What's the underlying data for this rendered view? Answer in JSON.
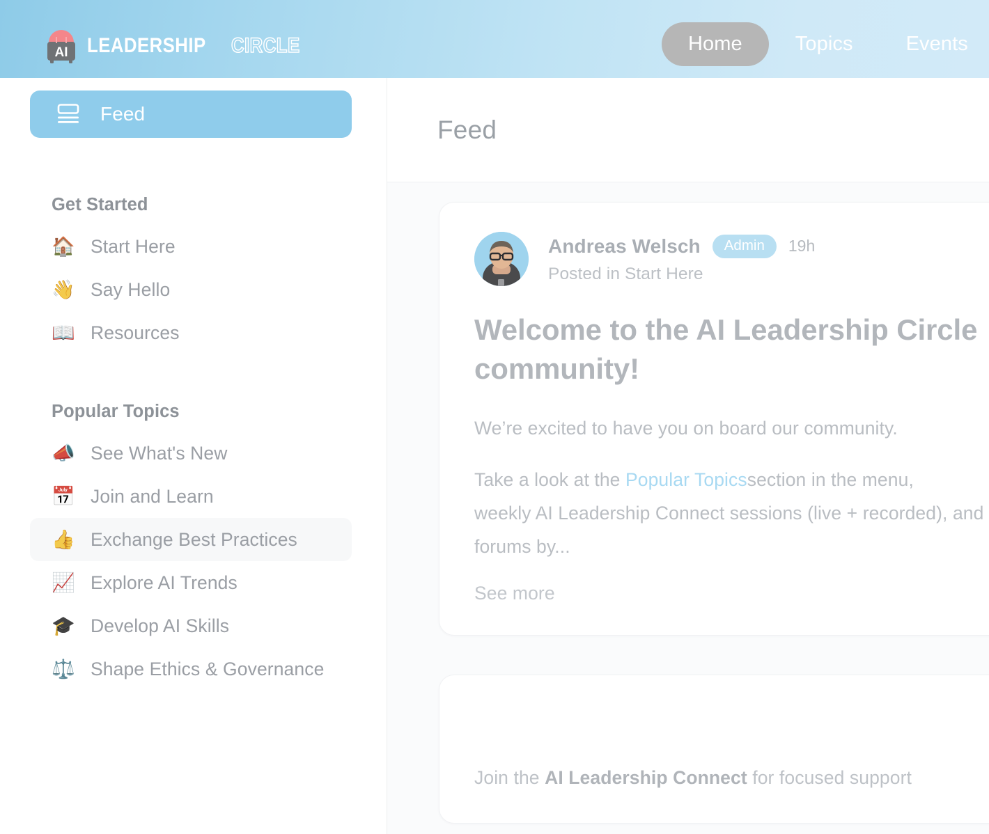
{
  "brand": {
    "logo_icon": "ai-robot-head-icon",
    "word_solid": "LEADERSHIP",
    "word_outline": "CIRCLE",
    "mark_text": "AI",
    "colors": {
      "dome": "#f4868a",
      "body": "#6f7275",
      "header_left": "#8ecbe8",
      "header_right": "#d2eaf8"
    }
  },
  "topnav": {
    "items": [
      {
        "label": "Home",
        "active": true
      },
      {
        "label": "Topics",
        "active": false
      },
      {
        "label": "Events",
        "active": false
      }
    ],
    "active_pill_color": "#b6b6b6"
  },
  "sidebar": {
    "feed": {
      "label": "Feed",
      "icon": "feed-icon",
      "active": true,
      "accent": "#8fcceb"
    },
    "sections": [
      {
        "title": "Get Started",
        "items": [
          {
            "emoji": "🏠",
            "icon_name": "house-emoji",
            "label": "Start Here",
            "hovered": false
          },
          {
            "emoji": "👋",
            "icon_name": "waving-hand-emoji",
            "label": "Say Hello",
            "hovered": false
          },
          {
            "emoji": "📖",
            "icon_name": "open-book-emoji",
            "label": "Resources",
            "hovered": false
          }
        ]
      },
      {
        "title": "Popular Topics",
        "items": [
          {
            "emoji": "📣",
            "icon_name": "megaphone-emoji",
            "label": "See What's New",
            "hovered": false
          },
          {
            "emoji": "📅",
            "icon_name": "calendar-emoji",
            "label": "Join and Learn",
            "hovered": false
          },
          {
            "emoji": "👍",
            "icon_name": "thumbs-up-emoji",
            "label": "Exchange Best Practices",
            "hovered": true
          },
          {
            "emoji": "📈",
            "icon_name": "chart-increasing-emoji",
            "label": "Explore AI Trends",
            "hovered": false
          },
          {
            "emoji": "🎓",
            "icon_name": "graduation-cap-emoji",
            "label": "Develop AI Skills",
            "hovered": false
          },
          {
            "emoji": "⚖️",
            "icon_name": "balance-scale-emoji",
            "label": "Shape Ethics & Governance",
            "hovered": false
          }
        ]
      }
    ]
  },
  "main": {
    "page_title": "Feed",
    "posts": [
      {
        "author": "Andreas Welsch",
        "badge": "Admin",
        "time": "19h",
        "posted_in": "Posted in Start Here",
        "title_line1": "Welcome to the AI Leadership Circle",
        "title_line2": "community!",
        "body_line1": "We’re excited to have you on board our community.",
        "body_line2_pre": "Take a look at the ",
        "body_line2_link": "Popular Topics",
        "body_line2_post": "section in the menu,",
        "body_line3": "weekly AI Leadership Connect sessions (live + recorded), and",
        "body_line4": "forums by...",
        "see_more": "See more"
      },
      {
        "promo_pre": "Join the ",
        "promo_bold": "AI Leadership Connect",
        "promo_post": " for focused support"
      }
    ]
  }
}
